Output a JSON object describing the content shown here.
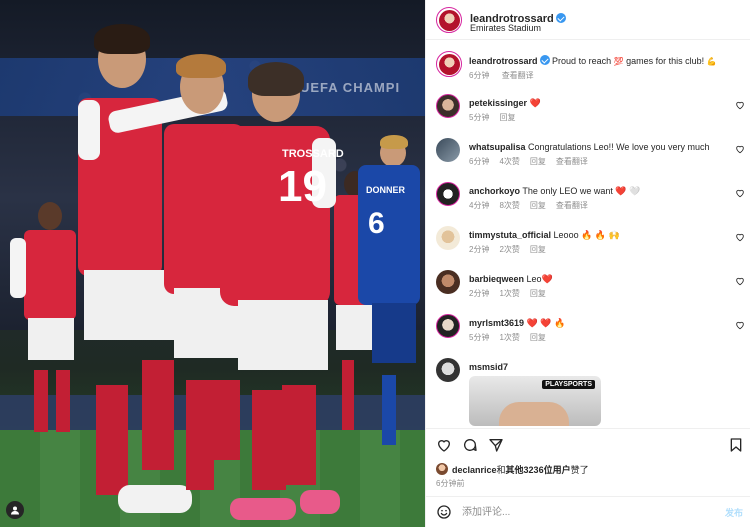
{
  "photo": {
    "stadium_board_text": "UEFA CHAMPI",
    "player_name": "TROSSARD",
    "player_number": "19",
    "opponent_number": "6",
    "opponent_name": "DONNER"
  },
  "header": {
    "username": "leandrotrossard",
    "location": "Emirates Stadium"
  },
  "caption": {
    "username": "leandrotrossard",
    "text": "Proud to reach",
    "emoji1": "💯",
    "text2": "games for this club!",
    "emoji2": "💪",
    "time": "6分钟",
    "translate": "查看翻译"
  },
  "comments": [
    {
      "user": "petekissinger",
      "text": "❤️",
      "time": "5分钟",
      "likes": "",
      "reply": "回复",
      "translate": ""
    },
    {
      "user": "whatsupalisa",
      "text": "Congratulations Leo!! We love you very much",
      "time": "6分钟",
      "likes": "4次赞",
      "reply": "回复",
      "translate": "查看翻译"
    },
    {
      "user": "anchorkoyo",
      "text": "The only LEO we want ❤️ 🤍",
      "time": "4分钟",
      "likes": "8次赞",
      "reply": "回复",
      "translate": "查看翻译"
    },
    {
      "user": "timmystuta_official",
      "text": "Leooo 🔥 🔥 🙌",
      "time": "2分钟",
      "likes": "2次赞",
      "reply": "回复",
      "translate": ""
    },
    {
      "user": "barbieqween",
      "text": "Leo❤️",
      "time": "2分钟",
      "likes": "1次赞",
      "reply": "回复",
      "translate": ""
    },
    {
      "user": "myrlsmt3619",
      "text": "❤️ ❤️ 🔥",
      "time": "5分钟",
      "likes": "1次赞",
      "reply": "回复",
      "translate": ""
    },
    {
      "user": "msmsid7",
      "text": "",
      "time": "",
      "likes": "",
      "reply": "",
      "translate": ""
    }
  ],
  "thumb": {
    "logo": "PLAYSPORTS"
  },
  "likes": {
    "user": "declanrice",
    "connector": "和",
    "others": "其他3236位用户",
    "suffix": "赞了"
  },
  "post_time": "6分钟前",
  "composer": {
    "placeholder": "添加评论...",
    "post_label": "发布"
  },
  "colors": {
    "verified": "#3897f0",
    "heart": "#ed4956",
    "link_disabled": "#b2dffc"
  }
}
